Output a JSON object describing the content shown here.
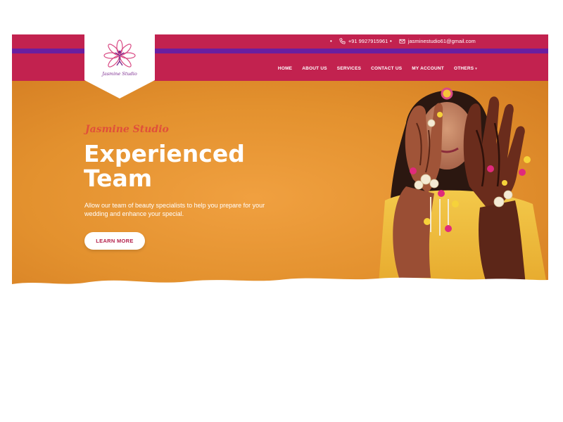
{
  "header": {
    "phone": "+91 9927915961",
    "email": "jasminestudio61@gmail.com",
    "logo_text": "Jasmine Studio",
    "nav": [
      {
        "label": "HOME"
      },
      {
        "label": "ABOUT US"
      },
      {
        "label": "SERVICES"
      },
      {
        "label": "CONTACT US"
      },
      {
        "label": "MY ACCOUNT"
      },
      {
        "label": "OTHERS"
      }
    ]
  },
  "hero": {
    "brand": "Jasmine Studio",
    "headline_line1": "Experienced",
    "headline_line2": "Team",
    "description": "Allow our team of beauty specialists to help you prepare for your wedding and enhance your special.",
    "cta_label": "LEARN MORE"
  },
  "colors": {
    "topbar": "#c2224f",
    "stripe": "#6a1fa0",
    "hero_bg": "#e3912e",
    "brand_script": "#e0503a",
    "cta_text": "#b4214c"
  },
  "icons": {
    "phone": "phone-icon",
    "email": "envelope-icon",
    "logo": "lotus-dancer-icon"
  }
}
